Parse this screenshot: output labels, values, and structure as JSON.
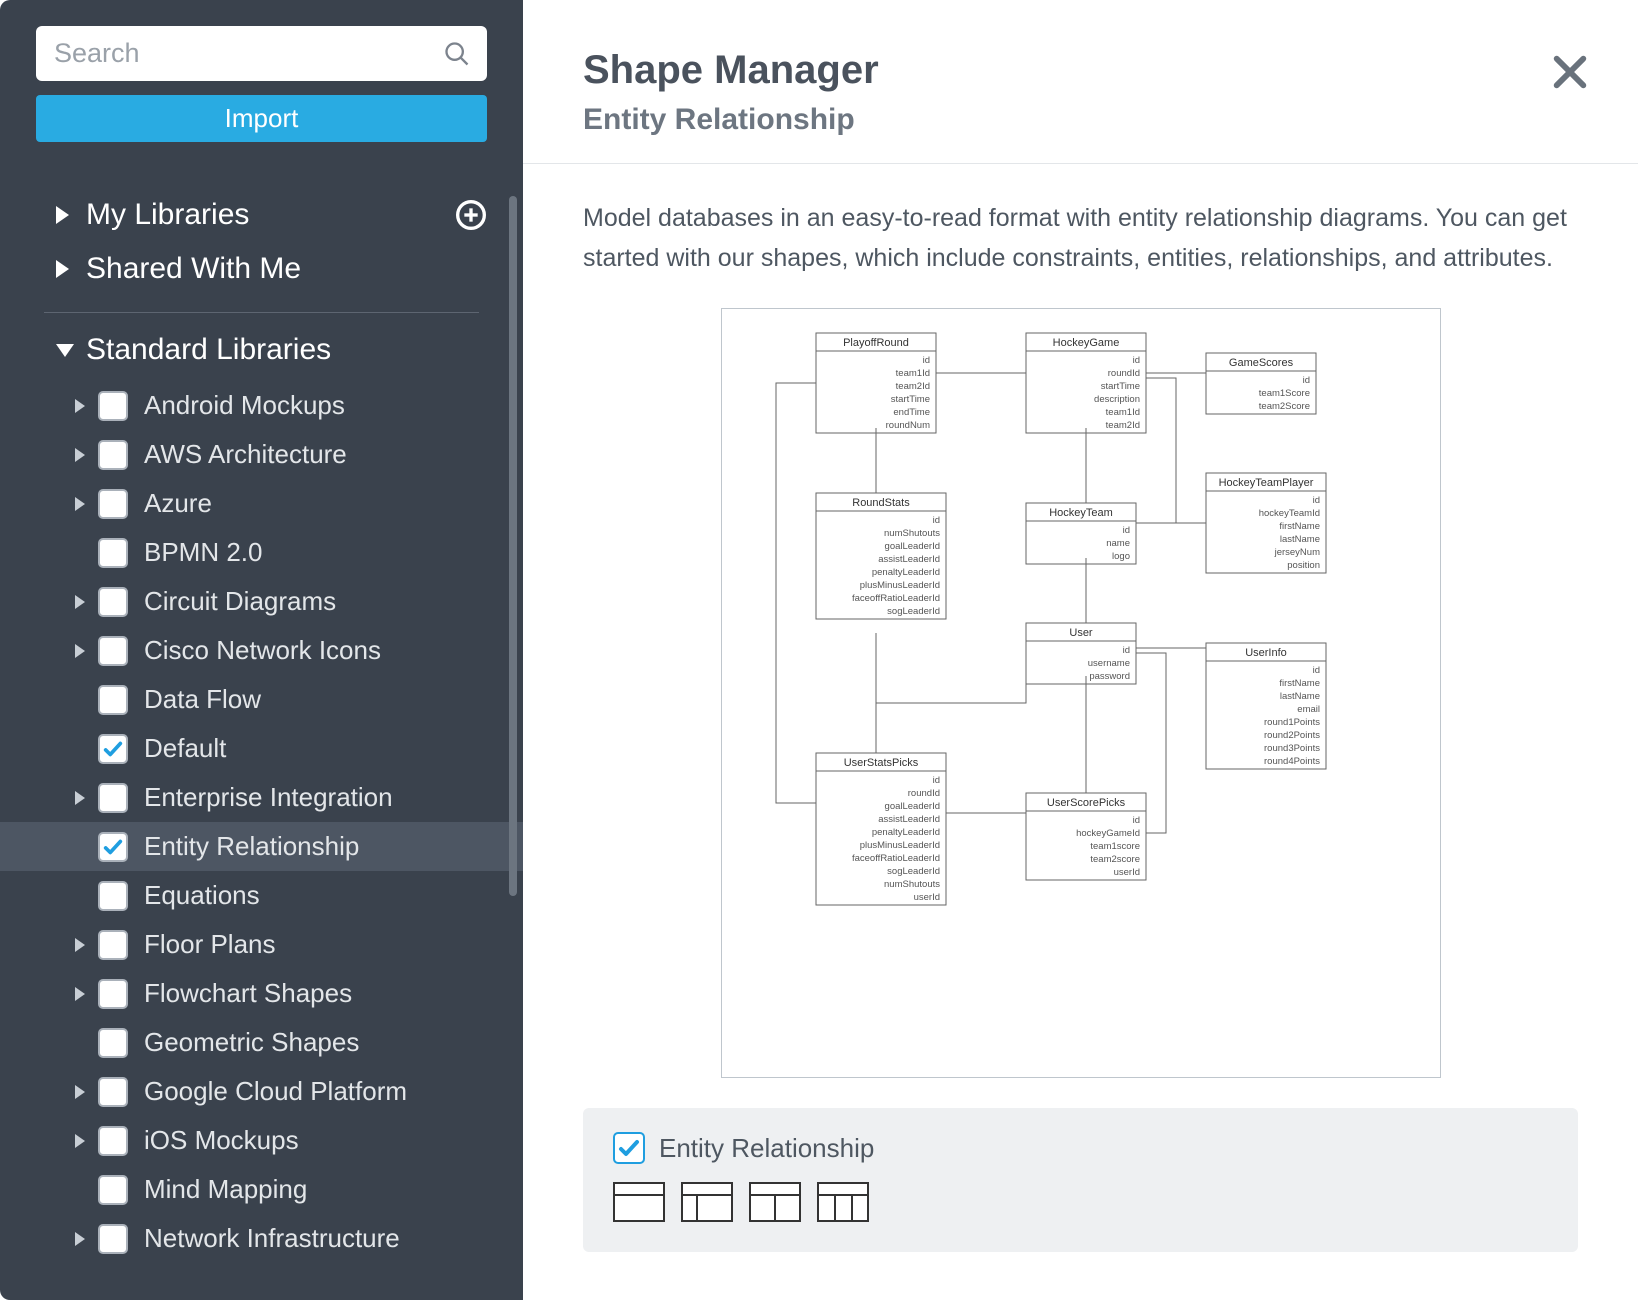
{
  "sidebar": {
    "search_placeholder": "Search",
    "import_label": "Import",
    "sections": {
      "my_libraries": "My Libraries",
      "shared_with_me": "Shared With Me",
      "standard_libraries": "Standard Libraries"
    },
    "libraries": [
      {
        "label": "Android Mockups",
        "checked": false,
        "expandable": true,
        "selected": false
      },
      {
        "label": "AWS Architecture",
        "checked": false,
        "expandable": true,
        "selected": false
      },
      {
        "label": "Azure",
        "checked": false,
        "expandable": true,
        "selected": false
      },
      {
        "label": "BPMN 2.0",
        "checked": false,
        "expandable": false,
        "selected": false
      },
      {
        "label": "Circuit Diagrams",
        "checked": false,
        "expandable": true,
        "selected": false
      },
      {
        "label": "Cisco Network Icons",
        "checked": false,
        "expandable": true,
        "selected": false
      },
      {
        "label": "Data Flow",
        "checked": false,
        "expandable": false,
        "selected": false
      },
      {
        "label": "Default",
        "checked": true,
        "expandable": false,
        "selected": false
      },
      {
        "label": "Enterprise Integration",
        "checked": false,
        "expandable": true,
        "selected": false
      },
      {
        "label": "Entity Relationship",
        "checked": true,
        "expandable": false,
        "selected": true
      },
      {
        "label": "Equations",
        "checked": false,
        "expandable": false,
        "selected": false
      },
      {
        "label": "Floor Plans",
        "checked": false,
        "expandable": true,
        "selected": false
      },
      {
        "label": "Flowchart Shapes",
        "checked": false,
        "expandable": true,
        "selected": false
      },
      {
        "label": "Geometric Shapes",
        "checked": false,
        "expandable": false,
        "selected": false
      },
      {
        "label": "Google Cloud Platform",
        "checked": false,
        "expandable": true,
        "selected": false
      },
      {
        "label": "iOS Mockups",
        "checked": false,
        "expandable": true,
        "selected": false
      },
      {
        "label": "Mind Mapping",
        "checked": false,
        "expandable": false,
        "selected": false
      },
      {
        "label": "Network Infrastructure",
        "checked": false,
        "expandable": true,
        "selected": false
      }
    ]
  },
  "main": {
    "title": "Shape Manager",
    "subtitle": "Entity Relationship",
    "description": "Model databases in an easy-to-read format with entity relationship diagrams. You can get started with our shapes, which include constraints, entities, relationships, and attributes.",
    "library_box": {
      "title": "Entity Relationship",
      "checked": true
    },
    "preview_entities": {
      "PlayoffRound": [
        "id",
        "team1Id",
        "team2Id",
        "startTime",
        "endTime",
        "roundNum"
      ],
      "HockeyGame": [
        "id",
        "roundId",
        "startTime",
        "description",
        "team1Id",
        "team2Id"
      ],
      "GameScores": [
        "id",
        "team1Score",
        "team2Score"
      ],
      "RoundStats": [
        "id",
        "numShutouts",
        "goalLeaderId",
        "assistLeaderId",
        "penaltyLeaderId",
        "plusMinusLeaderId",
        "faceoffRatioLeaderId",
        "sogLeaderId"
      ],
      "HockeyTeam": [
        "id",
        "name",
        "logo"
      ],
      "HockeyTeamPlayer": [
        "id",
        "hockeyTeamId",
        "firstName",
        "lastName",
        "jerseyNum",
        "position"
      ],
      "User": [
        "id",
        "username",
        "password"
      ],
      "UserInfo": [
        "id",
        "firstName",
        "lastName",
        "email",
        "round1Points",
        "round2Points",
        "round3Points",
        "round4Points"
      ],
      "UserStatsPicks": [
        "id",
        "roundId",
        "goalLeaderId",
        "assistLeaderId",
        "penaltyLeaderId",
        "plusMinusLeaderId",
        "faceoffRatioLeaderId",
        "sogLeaderId",
        "numShutouts",
        "userId"
      ],
      "UserScorePicks": [
        "id",
        "hockeyGameId",
        "team1score",
        "team2score",
        "userId"
      ]
    }
  }
}
